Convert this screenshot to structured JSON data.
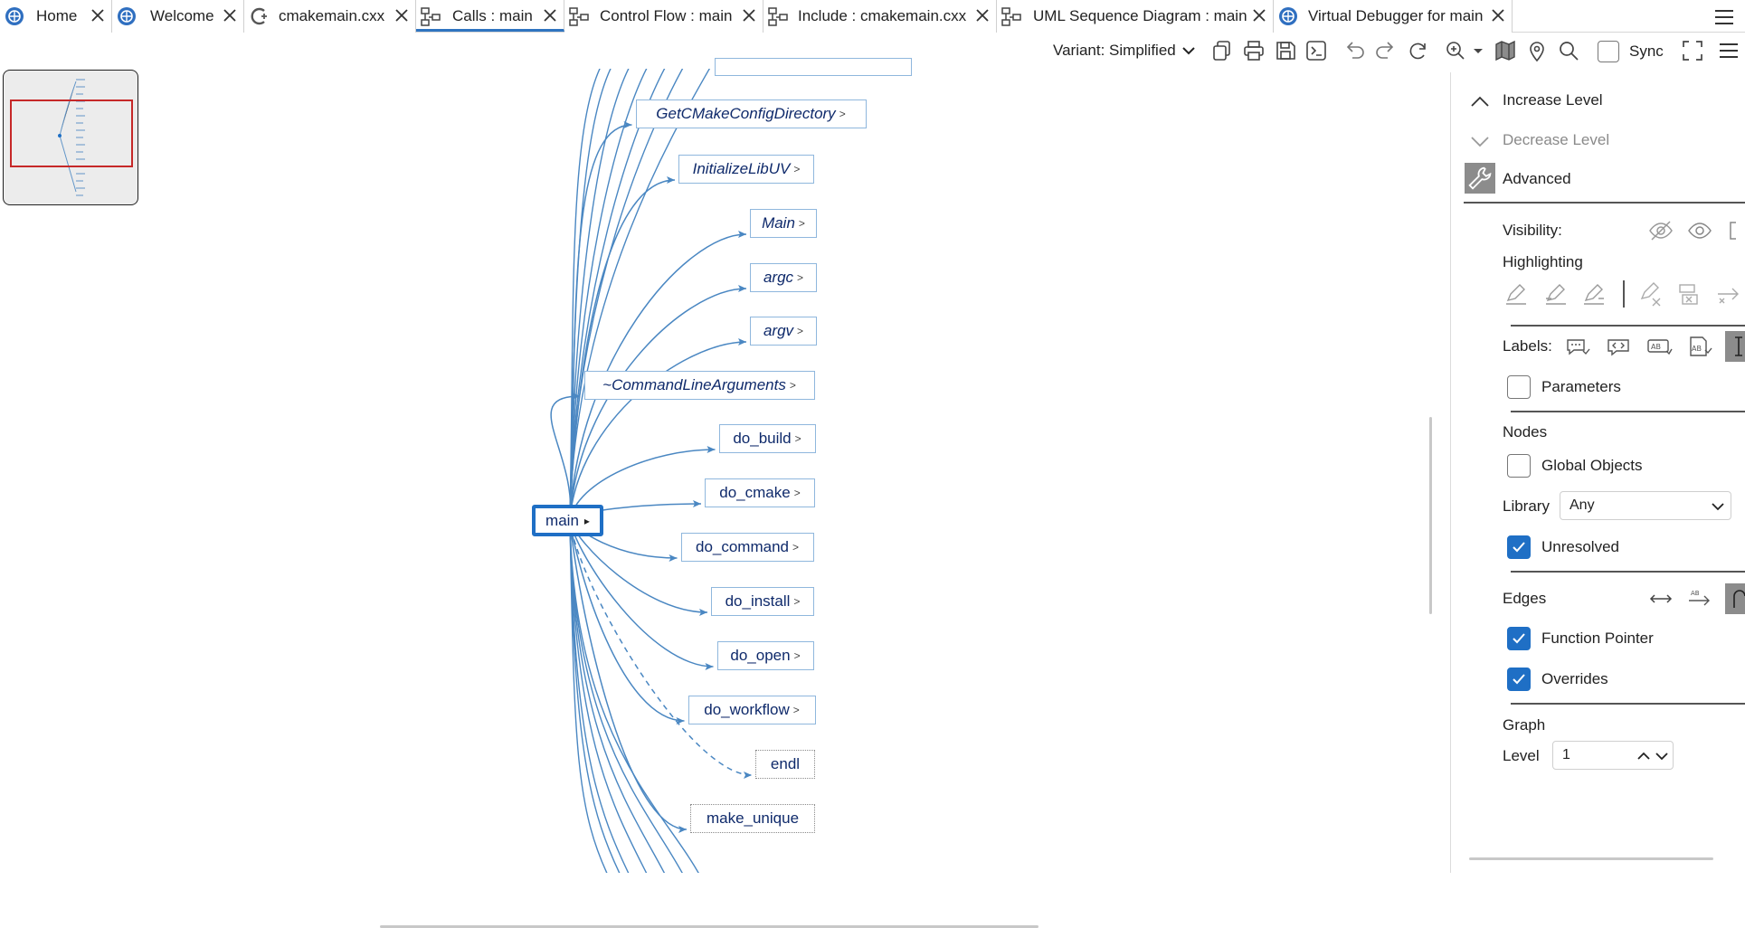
{
  "tabs": [
    {
      "label": "Home",
      "icon": "debugger-globe-icon"
    },
    {
      "label": "Welcome",
      "icon": "debugger-globe-icon"
    },
    {
      "label": "cmakemain.cxx",
      "icon": "cpp-file-icon"
    },
    {
      "label": "Calls : main",
      "icon": "graph-icon",
      "active": true
    },
    {
      "label": "Control Flow : main",
      "icon": "graph-icon"
    },
    {
      "label": "Include : cmakemain.cxx",
      "icon": "graph-icon"
    },
    {
      "label": "UML Sequence Diagram : main",
      "icon": "graph-icon"
    },
    {
      "label": "Virtual Debugger for main",
      "icon": "debugger-globe-icon"
    }
  ],
  "toolbar": {
    "variant_label": "Variant: Simplified",
    "sync_label": "Sync",
    "buttons": [
      "copy-icon",
      "print-icon",
      "save-icon",
      "terminal-icon",
      "undo-icon",
      "redo-icon",
      "refresh-icon",
      "zoom-in-icon",
      "zoom-dropdown-icon",
      "map-icon",
      "location-pin-icon",
      "search-icon",
      "fullscreen-icon",
      "menu-icon"
    ]
  },
  "graph": {
    "root": {
      "label": "main",
      "expand": "▸"
    },
    "expand_marker": ">",
    "nodes": [
      {
        "label": "GetCMakeConfigDirectory",
        "italic": true
      },
      {
        "label": "InitializeLibUV",
        "italic": true
      },
      {
        "label": "Main",
        "italic": true
      },
      {
        "label": "argc",
        "italic": true
      },
      {
        "label": "argv",
        "italic": true
      },
      {
        "label": "~CommandLineArguments",
        "italic": true
      },
      {
        "label": "do_build"
      },
      {
        "label": "do_cmake"
      },
      {
        "label": "do_command"
      },
      {
        "label": "do_install"
      },
      {
        "label": "do_open"
      },
      {
        "label": "do_workflow"
      },
      {
        "label": "endl",
        "unresolved": true
      },
      {
        "label": "make_unique",
        "unresolved": true
      }
    ]
  },
  "panel": {
    "increase_level": "Increase Level",
    "decrease_level": "Decrease Level",
    "advanced": "Advanced",
    "visibility_label": "Visibility:",
    "highlighting_label": "Highlighting",
    "labels_label": "Labels:",
    "parameters_label": "Parameters",
    "parameters_checked": false,
    "nodes_heading": "Nodes",
    "global_objects_label": "Global Objects",
    "global_objects_checked": false,
    "library_label": "Library",
    "library_value": "Any",
    "unresolved_label": "Unresolved",
    "unresolved_checked": true,
    "edges_heading": "Edges",
    "function_pointer_label": "Function Pointer",
    "function_pointer_checked": true,
    "overrides_label": "Overrides",
    "overrides_checked": true,
    "graph_heading": "Graph",
    "level_label": "Level",
    "level_value": "1"
  },
  "colors": {
    "accent": "#1f6fc5",
    "edge": "#4a87c2",
    "node_text": "#0f2a6b",
    "node_border": "#8fb7dd",
    "minimap_viewport": "#c62828"
  }
}
